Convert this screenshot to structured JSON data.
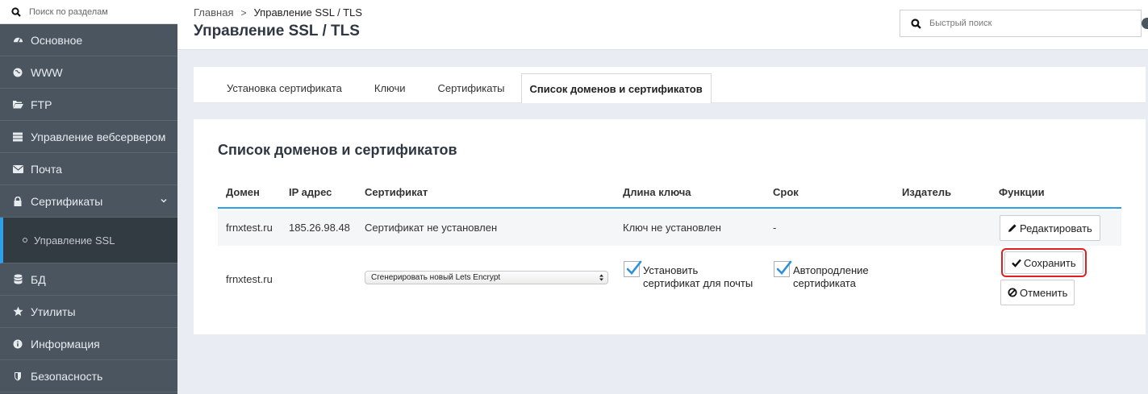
{
  "sidebar": {
    "search_placeholder": "Поиск по разделам",
    "items": [
      {
        "label": "Основное",
        "icon": "dashboard-icon"
      },
      {
        "label": "WWW",
        "icon": "globe-icon"
      },
      {
        "label": "FTP",
        "icon": "folder-icon"
      },
      {
        "label": "Управление вебсервером",
        "icon": "server-icon"
      },
      {
        "label": "Почта",
        "icon": "envelope-icon"
      },
      {
        "label": "Сертификаты",
        "icon": "lock-icon"
      }
    ],
    "sub_item": "Управление SSL",
    "items_after": [
      {
        "label": "БД",
        "icon": "database-icon"
      },
      {
        "label": "Утилиты",
        "icon": "star-icon"
      },
      {
        "label": "Информация",
        "icon": "info-icon"
      },
      {
        "label": "Безопасность",
        "icon": "shield-icon"
      }
    ]
  },
  "header": {
    "breadcrumb_home": "Главная",
    "breadcrumb_sep": ">",
    "breadcrumb_current": "Управление SSL / TLS",
    "title": "Управление SSL / TLS",
    "quick_search_placeholder": "Быстрый поиск"
  },
  "tabs": [
    {
      "label": "Установка сертификата",
      "active": false
    },
    {
      "label": "Ключи",
      "active": false
    },
    {
      "label": "Сертификаты",
      "active": false
    },
    {
      "label": "Список доменов и сертификатов",
      "active": true
    }
  ],
  "section": {
    "title": "Список доменов и сертификатов",
    "columns": [
      "Домен",
      "IP адрес",
      "Сертификат",
      "Длина ключа",
      "Срок",
      "Издатель",
      "Функции"
    ],
    "row1": {
      "domain": "frnxtest.ru",
      "ip": "185.26.98.48",
      "certificate": "Сертификат не установлен",
      "key_length": "Ключ не установлен",
      "term": "-",
      "edit_label": "Редактировать"
    },
    "row2": {
      "domain": "frnxtest.ru",
      "select_value": "Сгенерировать новый Lets Encrypt",
      "mail_cert_line1": "Установить",
      "mail_cert_line2": "сертификат для почты",
      "mail_cert_checked": true,
      "autorenew_line1": "Автопродление",
      "autorenew_line2": "сертификата",
      "autorenew_checked": true,
      "save_label": "Сохранить",
      "cancel_label": "Отменить"
    }
  },
  "colors": {
    "sidebar_bg": "#4a5560",
    "accent": "#2f9fe8",
    "highlight": "#e02020"
  }
}
